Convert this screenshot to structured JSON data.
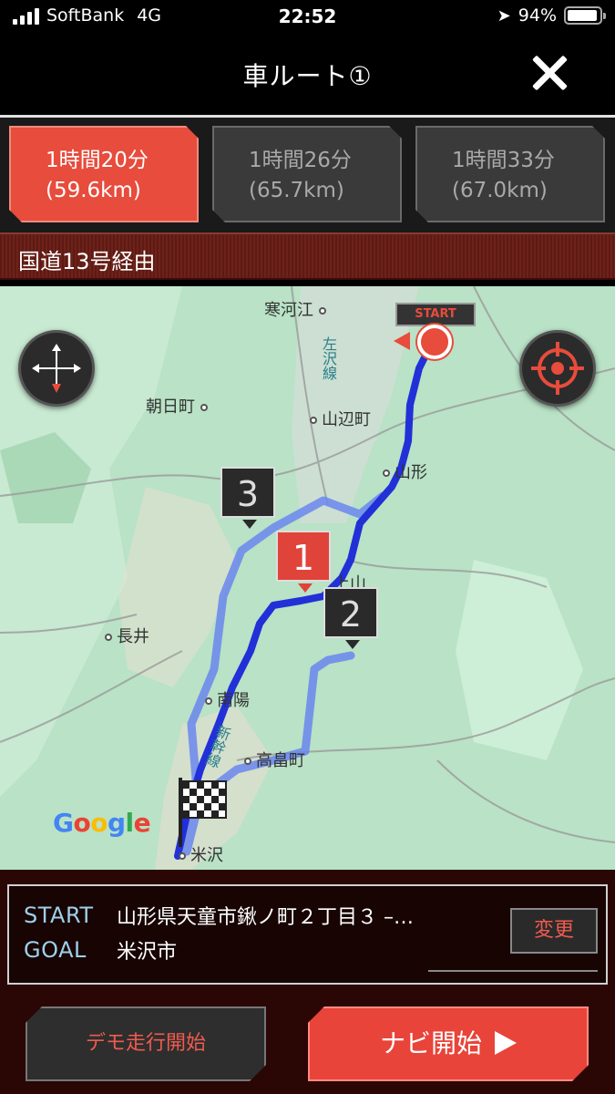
{
  "status_bar": {
    "carrier": "SoftBank",
    "network": "4G",
    "time": "22:52",
    "battery": "94%",
    "battery_level": 0.94
  },
  "header": {
    "title": "車ルート①"
  },
  "routes": [
    {
      "tag": "1",
      "time": "1時間20分",
      "distance": "(59.6km)",
      "selected": true
    },
    {
      "tag": "2",
      "time": "1時間26分",
      "distance": "(65.7km)",
      "selected": false
    },
    {
      "tag": "3",
      "time": "1時間33分",
      "distance": "(67.0km)",
      "selected": false
    }
  ],
  "via": "国道13号経由",
  "map": {
    "places": {
      "sagae": "寒河江",
      "sakura": "左沢線",
      "asahi": "朝日町",
      "yamanobe": "山辺町",
      "yamagata": "山形",
      "kaminoyama": "上山",
      "nagai": "長井",
      "nanyo": "南陽",
      "takahata": "高畠町",
      "yonezawa": "米沢",
      "shinkansen": "新幹線"
    },
    "start_marker": "START",
    "attribution": [
      "G",
      "o",
      "o",
      "g",
      "l",
      "e"
    ],
    "route_colors": {
      "selected": "#2230d8",
      "alternative": "#5a78e8"
    }
  },
  "trip": {
    "start_label": "START",
    "start_value": "山形県天童市鍬ノ町２丁目３ –…",
    "goal_label": "GOAL",
    "goal_value": "米沢市",
    "change_label": "変更"
  },
  "actions": {
    "demo_label": "デモ走行開始",
    "navi_label": "ナビ開始"
  }
}
